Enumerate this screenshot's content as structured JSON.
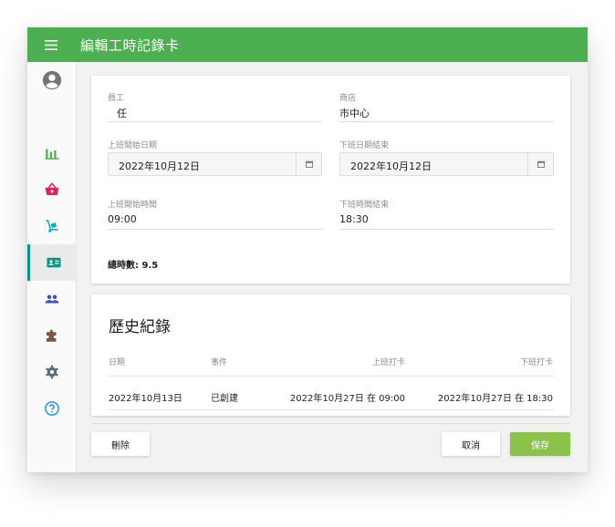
{
  "appbar": {
    "title": "編輯工時記錄卡",
    "menu_icon": "menu-icon"
  },
  "sidebar": {
    "items": [
      {
        "name": "profile",
        "icon": "account-circle-icon",
        "color": "#757575"
      },
      {
        "name": "stats",
        "icon": "bar-chart-icon",
        "color": "#4caf50"
      },
      {
        "name": "shop",
        "icon": "shopping-basket-icon",
        "color": "#e91e63"
      },
      {
        "name": "delivery",
        "icon": "hand-truck-icon",
        "color": "#00acc1"
      },
      {
        "name": "timecard",
        "icon": "badge-icon",
        "color": "#009688",
        "active": true
      },
      {
        "name": "people",
        "icon": "people-icon",
        "color": "#3f51b5"
      },
      {
        "name": "plugins",
        "icon": "puzzle-icon",
        "color": "#795548"
      },
      {
        "name": "settings",
        "icon": "gear-icon",
        "color": "#546e7a"
      },
      {
        "name": "help",
        "icon": "help-icon",
        "color": "#2196f3"
      }
    ]
  },
  "form": {
    "employee": {
      "label": "員工",
      "value": "任"
    },
    "store": {
      "label": "商店",
      "value": "市中心"
    },
    "start_date": {
      "label": "上班開始日期",
      "value": "2022年10月12日"
    },
    "end_date": {
      "label": "下班日期結束",
      "value": "2022年10月12日"
    },
    "start_time": {
      "label": "上班開始時間",
      "value": "09:00"
    },
    "end_time": {
      "label": "下班時間結束",
      "value": "18:30"
    },
    "total_hours": "總時數: 9.5"
  },
  "history": {
    "title": "歷史紀錄",
    "columns": [
      "日期",
      "事件",
      "上班打卡",
      "下班打卡"
    ],
    "rows": [
      [
        "2022年10月13日",
        "已創建",
        "2022年10月27日 在 09:00",
        "2022年10月27日 在 18:30"
      ]
    ]
  },
  "actions": {
    "delete": "刪除",
    "cancel": "取消",
    "save": "保存"
  },
  "colors": {
    "primary": "#4caf50",
    "save": "#8bc34a",
    "accent": "#009688"
  }
}
